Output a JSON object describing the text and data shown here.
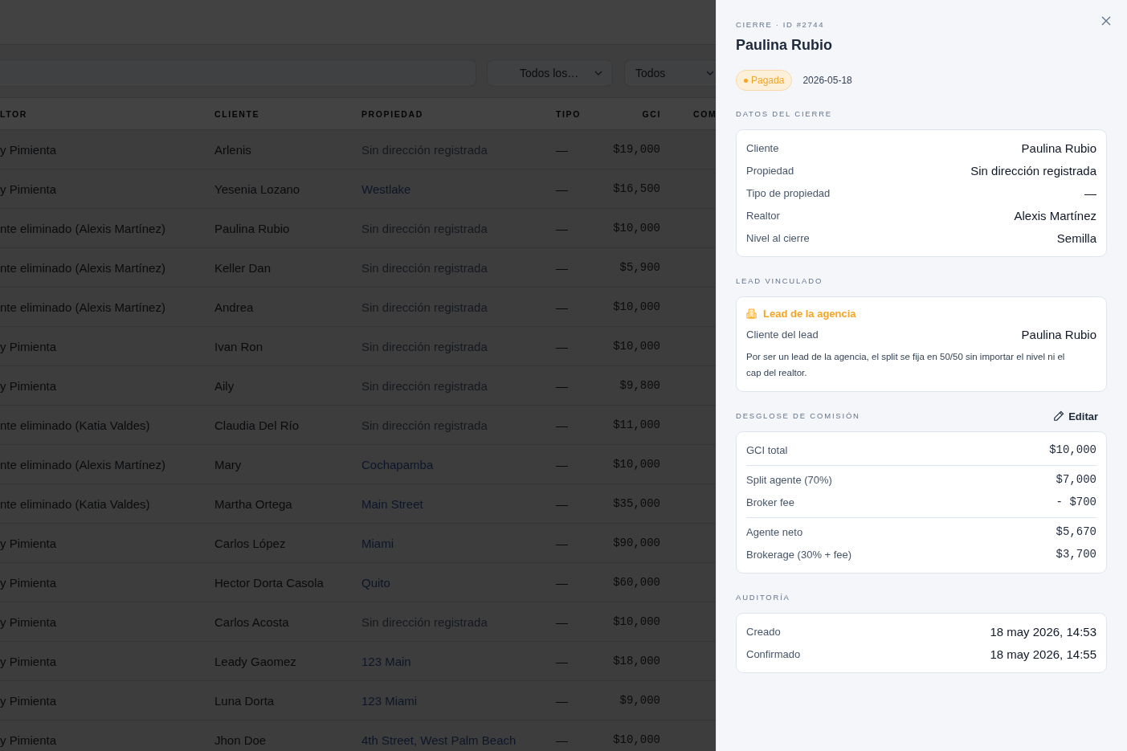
{
  "page": {
    "dimmed": true,
    "filters": [
      {
        "label": "Todos los…"
      },
      {
        "label": "Todos"
      }
    ],
    "table": {
      "columns": [
        "LTOR",
        "CLIENTE",
        "PROPIEDAD",
        "TIPO",
        "GCI",
        "COM"
      ],
      "rows": [
        {
          "realtor": "y Pimienta",
          "client": "Arlenis",
          "property": {
            "text": "Sin dirección registrada",
            "kind": "empty"
          },
          "type": "—",
          "gci": "$19,000"
        },
        {
          "realtor": "y Pimienta",
          "client": "Yesenia Lozano",
          "property": {
            "text": "Westlake",
            "kind": "link"
          },
          "type": "—",
          "gci": "$16,500"
        },
        {
          "realtor": "nte eliminado (Alexis Martínez)",
          "client": "Paulina Rubio",
          "property": {
            "text": "Sin dirección registrada",
            "kind": "empty"
          },
          "type": "—",
          "gci": "$10,000"
        },
        {
          "realtor": "nte eliminado (Alexis Martínez)",
          "client": "Keller Dan",
          "property": {
            "text": "Sin dirección registrada",
            "kind": "empty"
          },
          "type": "—",
          "gci": "$5,900"
        },
        {
          "realtor": "nte eliminado (Alexis Martínez)",
          "client": "Andrea",
          "property": {
            "text": "Sin dirección registrada",
            "kind": "empty"
          },
          "type": "—",
          "gci": "$10,000"
        },
        {
          "realtor": "y Pimienta",
          "client": "Ivan Ron",
          "property": {
            "text": "Sin dirección registrada",
            "kind": "empty"
          },
          "type": "—",
          "gci": "$10,000"
        },
        {
          "realtor": "y Pimienta",
          "client": "Aily",
          "property": {
            "text": "Sin dirección registrada",
            "kind": "empty"
          },
          "type": "—",
          "gci": "$9,800"
        },
        {
          "realtor": "nte eliminado (Katia Valdes)",
          "client": "Claudia Del Río",
          "property": {
            "text": "Sin dirección registrada",
            "kind": "empty"
          },
          "type": "—",
          "gci": "$11,000"
        },
        {
          "realtor": "nte eliminado (Alexis Martínez)",
          "client": "Mary",
          "property": {
            "text": "Cochapamba",
            "kind": "link"
          },
          "type": "—",
          "gci": "$10,000"
        },
        {
          "realtor": "nte eliminado (Katia Valdes)",
          "client": "Martha Ortega",
          "property": {
            "text": "Main Street",
            "kind": "link"
          },
          "type": "—",
          "gci": "$35,000"
        },
        {
          "realtor": "y Pimienta",
          "client": "Carlos López",
          "property": {
            "text": "Miami",
            "kind": "link"
          },
          "type": "—",
          "gci": "$90,000"
        },
        {
          "realtor": "y Pimienta",
          "client": "Hector Dorta Casola",
          "property": {
            "text": "Quito",
            "kind": "link"
          },
          "type": "—",
          "gci": "$60,000"
        },
        {
          "realtor": "y Pimienta",
          "client": "Carlos Acosta",
          "property": {
            "text": "Sin dirección registrada",
            "kind": "empty"
          },
          "type": "—",
          "gci": "$10,000"
        },
        {
          "realtor": "y Pimienta",
          "client": "Leady Gaomez",
          "property": {
            "text": "123 Main",
            "kind": "link"
          },
          "type": "—",
          "gci": "$18,000"
        },
        {
          "realtor": "y Pimienta",
          "client": "Luna Dorta",
          "property": {
            "text": "123 Miami",
            "kind": "link"
          },
          "type": "—",
          "gci": "$9,000"
        },
        {
          "realtor": "y Pimienta",
          "client": "Jhon Doe",
          "property": {
            "text": "4th Street, West Palm Beach",
            "kind": "link"
          },
          "type": "—",
          "gci": "$10,000"
        }
      ]
    }
  },
  "panel": {
    "eyebrow": "CIERRE · ID #2744",
    "title": "Paulina Rubio",
    "status": {
      "label": "Pagada",
      "kind": "paid"
    },
    "date": "2026-05-18",
    "closing_data": {
      "title": "DATOS DEL CIERRE",
      "rows": [
        {
          "label": "Cliente",
          "value": "Paulina Rubio"
        },
        {
          "label": "Propiedad",
          "value": "Sin dirección registrada"
        },
        {
          "label": "Tipo de propiedad",
          "value": "—"
        },
        {
          "label": "Realtor",
          "value": "Alexis Martínez"
        },
        {
          "label": "Nivel al cierre",
          "value": "Semilla"
        }
      ]
    },
    "linked_lead": {
      "title": "LEAD VINCULADO",
      "card_title": "Lead de la agencia",
      "rows": [
        {
          "label": "Cliente del lead",
          "value": "Paulina Rubio"
        }
      ],
      "note": "Por ser un lead de la agencia, el split se fija en 50/50 sin importar el nivel ni el cap del realtor."
    },
    "commission": {
      "title": "DESGLOSE DE COMISIÓN",
      "action": "Editar",
      "groups": [
        {
          "rows": [
            {
              "label": "GCI total",
              "value": "$10,000"
            }
          ]
        },
        {
          "rows": [
            {
              "label": "Split agente (70%)",
              "value": "$7,000"
            },
            {
              "label": "Broker fee",
              "value": "- $700"
            }
          ]
        },
        {
          "rows": [
            {
              "label": "Agente neto",
              "value": "$5,670"
            },
            {
              "label": "Brokerage (30% + fee)",
              "value": "$3,700"
            }
          ]
        }
      ]
    },
    "audit": {
      "title": "AUDITORÍA",
      "rows": [
        {
          "label": "Creado",
          "value": "18 may 2026, 14:53"
        },
        {
          "label": "Confirmado",
          "value": "18 may 2026, 14:55"
        }
      ]
    }
  }
}
